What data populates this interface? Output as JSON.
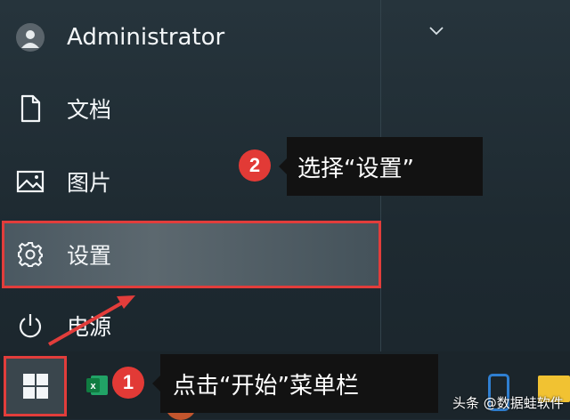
{
  "account": {
    "name": "Administrator"
  },
  "menu": {
    "documents": "文档",
    "pictures": "图片",
    "settings": "设置",
    "power": "电源"
  },
  "annotations": {
    "step1": {
      "number": "1",
      "text": "点击“开始”菜单栏"
    },
    "step2": {
      "number": "2",
      "text": "选择“设置”"
    },
    "highlight_color": "#e23d3b"
  },
  "taskbar": {
    "apps": [
      "windows-start",
      "excel",
      "app",
      "phone",
      "folder"
    ]
  },
  "watermark": "头条 @数据蛙软件"
}
